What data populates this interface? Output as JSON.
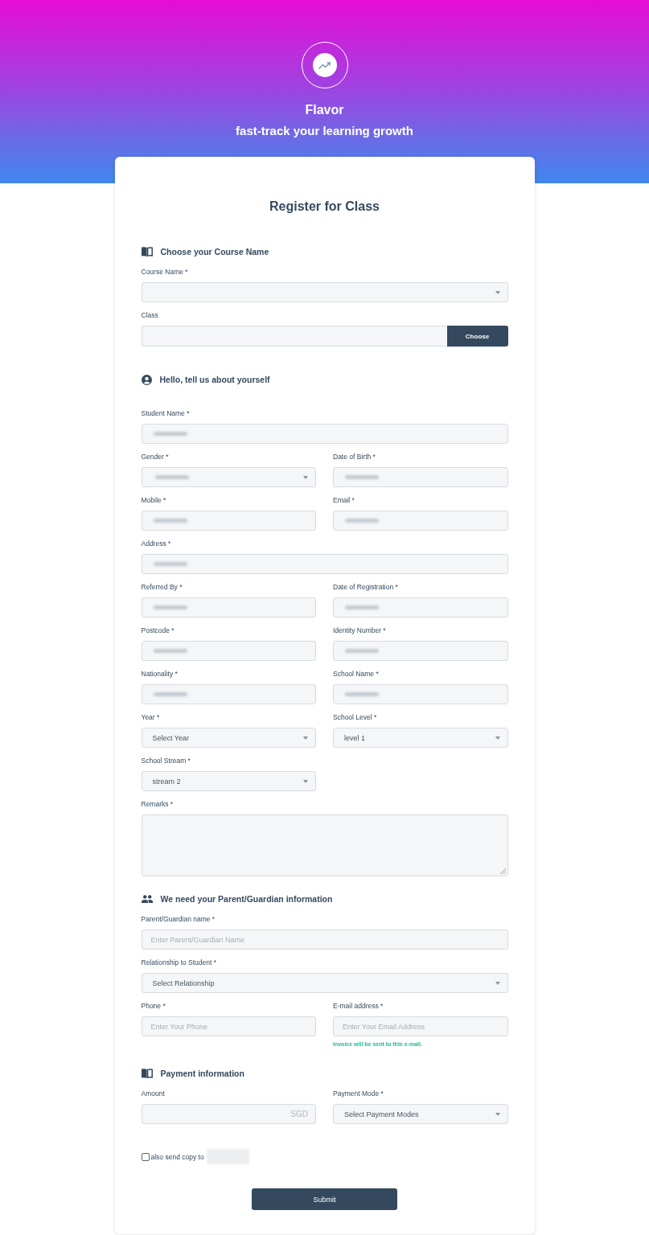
{
  "header": {
    "brand": "Flavor",
    "tagline": "fast-track your learning growth"
  },
  "form": {
    "title": "Register for Class",
    "sections": [
      {
        "kind": "course",
        "heading": "Choose your Course Name",
        "fields": [
          {
            "kind": "select",
            "label": "Course Name *",
            "wide": true,
            "value_blurred": false
          },
          {
            "kind": "text_button",
            "label": "Class",
            "wide": true,
            "value_blurred": false,
            "button": "Choose"
          }
        ]
      },
      {
        "kind": "personal",
        "heading": "Hello, tell us about yourself",
        "fields": [
          {
            "kind": "text",
            "label": "Student Name *",
            "wide": true,
            "value_blurred": true
          },
          {
            "kind": "select",
            "label": "Gender *",
            "wide": false,
            "value_blurred": true
          },
          {
            "kind": "text",
            "label": "Date of Birth *",
            "wide": false,
            "value_blurred": true
          },
          {
            "kind": "text",
            "label": "Mobile *",
            "wide": false,
            "value_blurred": true
          },
          {
            "kind": "text",
            "label": "Email *",
            "wide": false,
            "value_blurred": true
          },
          {
            "kind": "text",
            "label": "Address *",
            "wide": true,
            "value_blurred": true
          },
          {
            "kind": "text",
            "label": "Referred By *",
            "wide": false,
            "value_blurred": true
          },
          {
            "kind": "text",
            "label": "Date of Registration *",
            "wide": false,
            "value_blurred": true
          },
          {
            "kind": "text",
            "label": "Postcode *",
            "wide": false,
            "value_blurred": true
          },
          {
            "kind": "text",
            "label": "Identity Number *",
            "wide": false,
            "value_blurred": true
          },
          {
            "kind": "text",
            "label": "Nationality *",
            "wide": false,
            "value_blurred": true
          },
          {
            "kind": "text",
            "label": "School Name *",
            "wide": false,
            "value_blurred": true
          },
          {
            "kind": "select",
            "label": "Year *",
            "wide": false,
            "value_blurred": false,
            "value": "Select Year"
          },
          {
            "kind": "select",
            "label": "School Level *",
            "wide": false,
            "value_blurred": false,
            "value": "level 1"
          },
          {
            "kind": "select",
            "label": "School Stream *",
            "wide": false,
            "value_blurred": false,
            "value": "stream 2"
          },
          {
            "kind": "textarea",
            "label": "Remarks *",
            "wide": true,
            "value_blurred": false
          }
        ]
      },
      {
        "kind": "guardian",
        "heading": "We need your Parent/Guardian information",
        "fields": [
          {
            "kind": "text",
            "label": "Parent/Guardian name *",
            "wide": true,
            "value_blurred": false,
            "placeholder": "Enter Parent/Guardian Name"
          },
          {
            "kind": "select",
            "label": "Relationship to Student *",
            "wide": true,
            "value_blurred": false,
            "value": "Select Relationship"
          },
          {
            "kind": "text",
            "label": "Phone *",
            "wide": false,
            "value_blurred": false,
            "placeholder": "Enter Your Phone"
          },
          {
            "kind": "text",
            "label": "E-mail address *",
            "wide": false,
            "value_blurred": false,
            "placeholder": "Enter Your Email Address",
            "hint": "Invoice will be sent to this e-mail."
          }
        ]
      },
      {
        "kind": "payment",
        "heading": "Payment information",
        "fields": [
          {
            "kind": "text",
            "label": "Amount",
            "wide": false,
            "value_blurred": false,
            "suffix": "SGD"
          },
          {
            "kind": "select",
            "label": "Payment Mode *",
            "wide": false,
            "value_blurred": false,
            "value": "Select Payment Modes"
          }
        ]
      }
    ],
    "copy_option": {
      "label": "also send copy to",
      "checked": false,
      "recipient_blurred": true
    },
    "submit": "Submit"
  }
}
